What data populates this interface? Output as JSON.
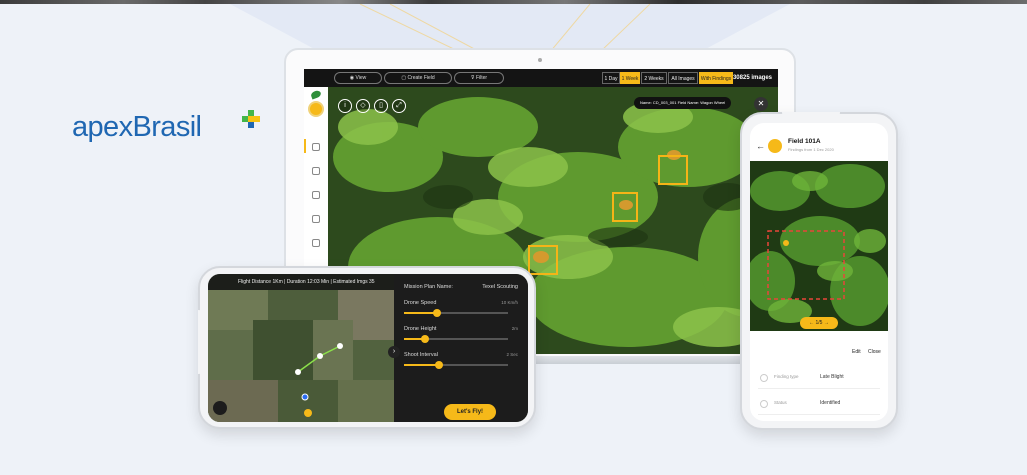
{
  "brand": {
    "name": "apexBrasil",
    "colors": {
      "blue": "#1f67b2",
      "green": "#43b649",
      "yellow": "#f6c313"
    }
  },
  "laptop": {
    "toolbar": {
      "view": "View",
      "create_field": "Create Field",
      "filter": "Filter",
      "ranges": [
        "1 Day",
        "1 Week",
        "2 Weeks",
        "All Images",
        "With Findings"
      ],
      "active_range": "1 Week",
      "image_count": "30825 images"
    },
    "image_info": "Name: CD_003_001   Field Name: Wagon Wheel",
    "close_icon": "close-icon"
  },
  "mission": {
    "flight_stats": "Flight Distance 1Km  |  Duration 12:03 Min  |  Estimated Imgs 35",
    "plan_label": "Mission Plan Name:",
    "plan_value": "Texel Scouting",
    "sliders": [
      {
        "label": "Drone Speed",
        "value": "10 Km/h",
        "level": 0.32
      },
      {
        "label": "Drone Height",
        "value": "2m",
        "level": 0.2
      },
      {
        "label": "Shoot Interval",
        "value": "2 Sec",
        "level": 0.34
      }
    ],
    "fly_button": "Let's Fly!"
  },
  "finding": {
    "title": "Field 101A",
    "subtitle": "Findings from 1 Dec 2020",
    "nav": "1/5",
    "edit": "Edit",
    "close": "Close",
    "rows": [
      {
        "key": "Finding type",
        "value": "Late Blight"
      },
      {
        "key": "Status",
        "value": "Identified"
      }
    ]
  },
  "accent": "#f6b919"
}
